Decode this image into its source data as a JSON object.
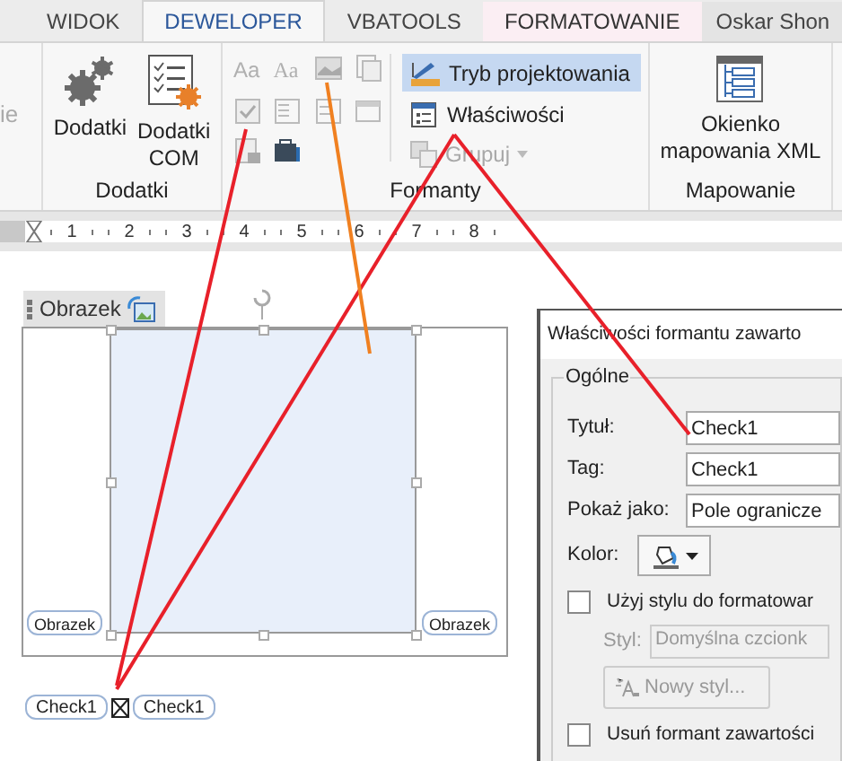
{
  "tabs": [
    {
      "label": "WIDOK",
      "selected": false,
      "kind": "plain"
    },
    {
      "label": "DEWELOPER",
      "selected": true,
      "kind": "plain"
    },
    {
      "label": "VBATOOLS",
      "selected": false,
      "kind": "plain"
    },
    {
      "label": "FORMATOWANIE",
      "selected": false,
      "kind": "contextual"
    }
  ],
  "user": "Oskar Shon",
  "ribbon": {
    "cut_label": "ie",
    "dodatki": {
      "buttons": [
        [
          "Dodatki"
        ],
        [
          "Dodatki",
          "COM"
        ]
      ],
      "label": "Dodatki"
    },
    "formanty": {
      "aa": [
        "Aa",
        "Aa"
      ],
      "design_mode": {
        "label": "Tryb projektowania",
        "selected": true
      },
      "properties": "Właściwości",
      "group": {
        "label": "Grupuj",
        "disabled": true
      },
      "label": "Formanty"
    },
    "mapowanie": {
      "button": [
        "Okienko",
        "mapowania XML"
      ],
      "label": "Mapowanie"
    }
  },
  "ruler": [
    "1",
    "2",
    "3",
    "4",
    "5",
    "6",
    "7",
    "8"
  ],
  "document": {
    "picture_title": "Obrazek",
    "picture_tags": [
      "Obrazek",
      "Obrazek"
    ],
    "check_tags": [
      "Check1",
      "Check1"
    ],
    "checkbox": {
      "checked": true
    }
  },
  "dialog": {
    "title": "Właściwości formantu zawarto",
    "section": "Ogólne",
    "fields": [
      {
        "label": "Tytuł:",
        "value": "Check1"
      },
      {
        "label": "Tag:",
        "value": "Check1"
      },
      {
        "label": "Pokaż jako:",
        "value": "Pole ogranicze"
      }
    ],
    "color_label": "Kolor:",
    "use_style": {
      "label": "Użyj stylu do formatowar",
      "checked": false
    },
    "style": {
      "label": "Styl:",
      "value": "Domyślna czcionk"
    },
    "new_style": {
      "label": "Nowy styl...",
      "disabled": true
    },
    "remove": {
      "label": "Usuń formant zawartości",
      "checked": false
    }
  }
}
